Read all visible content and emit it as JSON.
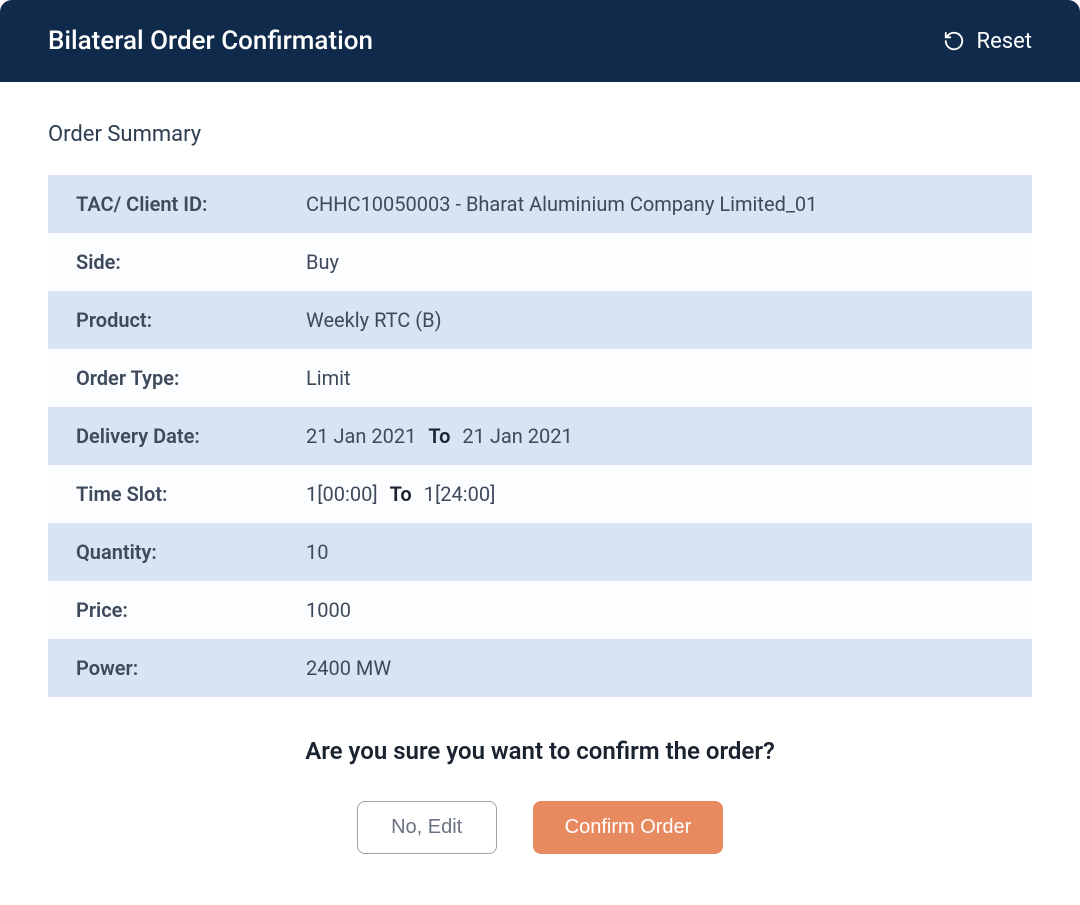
{
  "header": {
    "title": "Bilateral Order Confirmation",
    "reset_label": "Reset"
  },
  "section_title": "Order Summary",
  "rows": [
    {
      "label": "TAC/ Client ID:",
      "value": "CHHC10050003 - Bharat Aluminium Company Limited_01",
      "type": "simple"
    },
    {
      "label": "Side:",
      "value": "Buy",
      "type": "simple"
    },
    {
      "label": "Product:",
      "value": "Weekly RTC (B)",
      "type": "simple"
    },
    {
      "label": "Order Type:",
      "value": "Limit",
      "type": "simple"
    },
    {
      "label": "Delivery Date:",
      "from": "21 Jan 2021",
      "sep": "To",
      "to": "21 Jan 2021",
      "type": "range"
    },
    {
      "label": "Time Slot:",
      "from": "1[00:00]",
      "sep": "To",
      "to": "1[24:00]",
      "type": "range"
    },
    {
      "label": "Quantity:",
      "value": "10",
      "type": "simple"
    },
    {
      "label": "Price:",
      "value": "1000",
      "type": "simple"
    },
    {
      "label": "Power:",
      "value": "2400 MW",
      "type": "simple"
    }
  ],
  "confirm": {
    "question": "Are you sure you want to confirm the order?",
    "edit_label": "No, Edit",
    "confirm_label": "Confirm Order"
  }
}
